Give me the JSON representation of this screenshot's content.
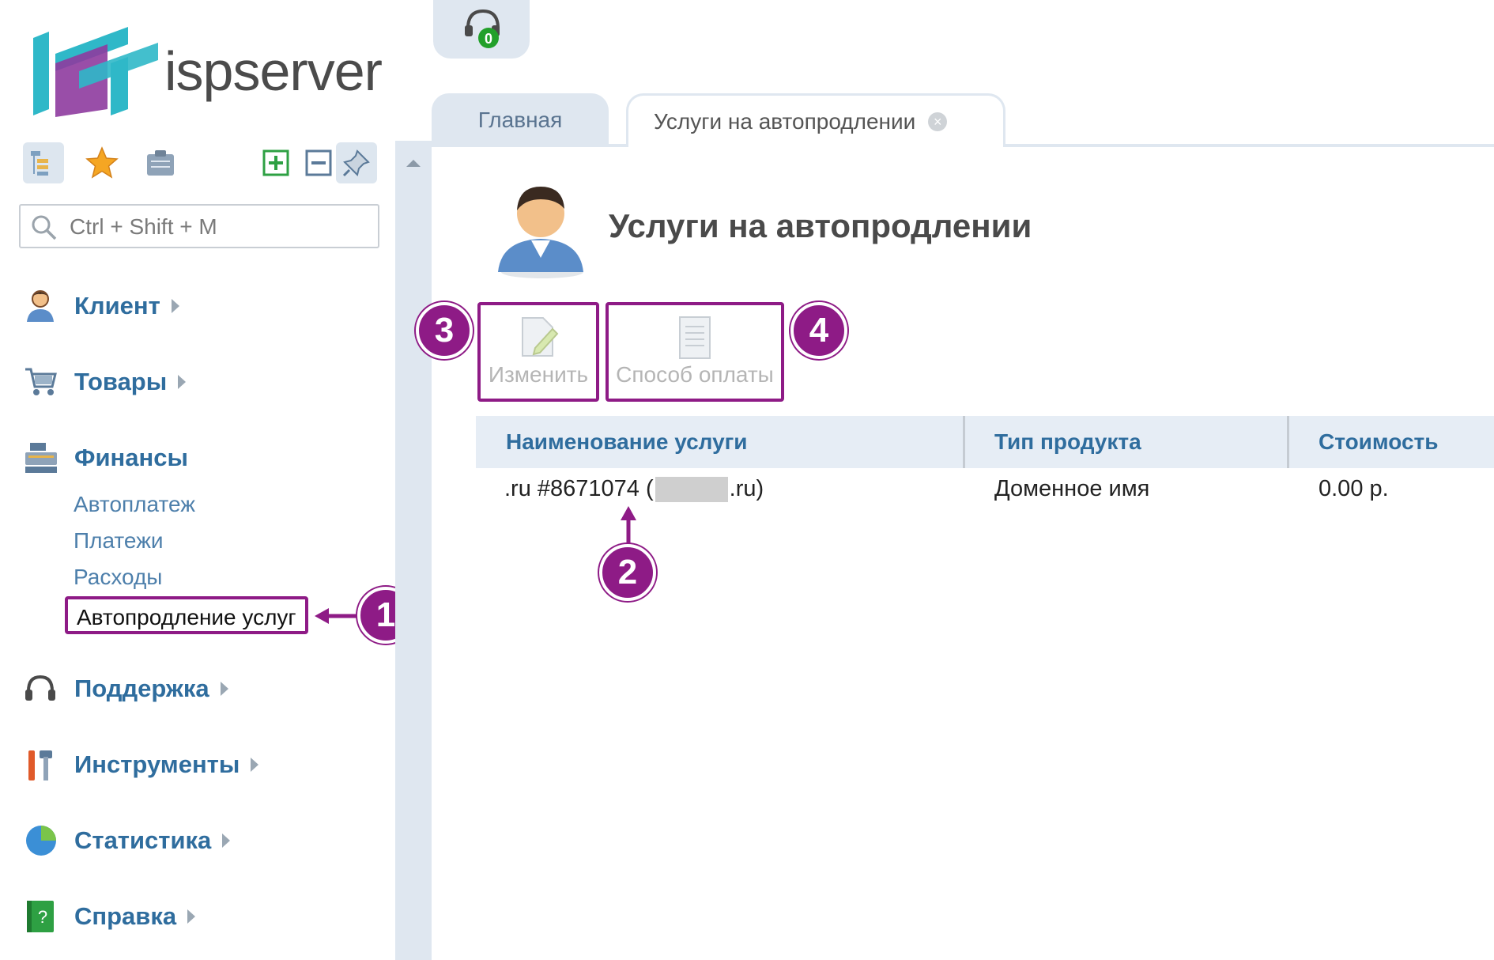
{
  "brand": {
    "name": "ispserver"
  },
  "search": {
    "placeholder": "Ctrl + Shift + M"
  },
  "sidebar": {
    "groups": [
      {
        "label": "Клиент"
      },
      {
        "label": "Товары"
      },
      {
        "label": "Финансы"
      },
      {
        "label": "Поддержка"
      },
      {
        "label": "Инструменты"
      },
      {
        "label": "Статистика"
      },
      {
        "label": "Справка"
      }
    ],
    "finance_items": [
      "Автоплатеж",
      "Платежи",
      "Расходы",
      "Автопродление услуг"
    ]
  },
  "support": {
    "badge": "0"
  },
  "tabs": [
    {
      "label": "Главная"
    },
    {
      "label": "Услуги на автопродлении"
    }
  ],
  "page": {
    "title": "Услуги на автопродлении",
    "actions": {
      "edit": "Изменить",
      "payment_method": "Способ оплаты"
    }
  },
  "table": {
    "columns": [
      "Наименование услуги",
      "Тип продукта",
      "Стоимость"
    ],
    "rows": [
      {
        "name_prefix": ".ru #8671074 (",
        "name_suffix": ".ru)",
        "type": "Доменное имя",
        "cost": "0.00 р."
      }
    ]
  },
  "callouts": [
    "1",
    "2",
    "3",
    "4"
  ],
  "colors": {
    "accent": "#8e1b86",
    "link": "#2f6d9e",
    "panel": "#dfe7f0"
  }
}
